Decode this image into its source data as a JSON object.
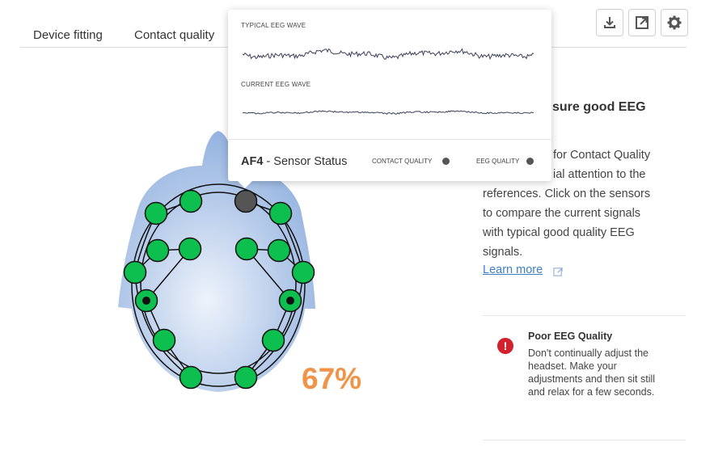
{
  "tabs": [
    "Device fitting",
    "Contact quality"
  ],
  "toolbar": {
    "download_icon": "download-icon",
    "open_icon": "external-link-icon",
    "settings_icon": "gear-icon"
  },
  "head": {
    "contact_percent": "67%"
  },
  "side": {
    "heading": "sure good EEG",
    "text_lines": [
      "for Contact Quality",
      "ial attention to the",
      "references. Click on the sensors",
      "to compare the current signals",
      "with typical good quality EEG",
      "signals."
    ],
    "learn_more": "Learn more"
  },
  "alert": {
    "title": "Poor EEG Quality",
    "body": "Don't continually adjust the headset. Make your adjustments and then sit still and relax for a few seconds.",
    "icon": "!"
  },
  "popup": {
    "typical_label": "TYPICAL EEG WAVE",
    "current_label": "CURRENT EEG WAVE",
    "sensor": "AF4",
    "sensor_suffix": " - Sensor Status",
    "contact_quality_label": "CONTACT QUALITY",
    "eeg_quality_label": "EEG QUALITY"
  },
  "colors": {
    "good": "#0cbf4e",
    "selected": "#555555",
    "accent": "#f0944a",
    "alert": "#d2222d"
  }
}
